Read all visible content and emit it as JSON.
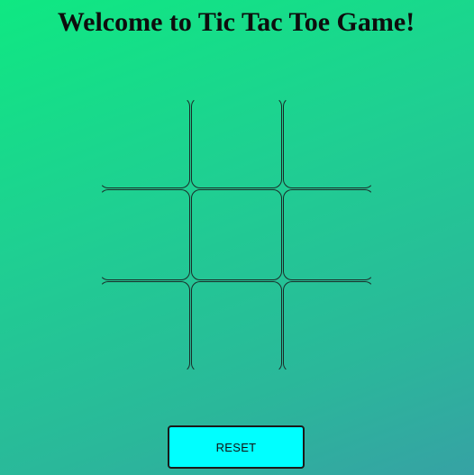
{
  "header": {
    "title": "Welcome to Tic Tac Toe Game!"
  },
  "board": {
    "cells": [
      "",
      "",
      "",
      "",
      "",
      "",
      "",
      "",
      ""
    ]
  },
  "controls": {
    "reset_label": "RESET"
  },
  "colors": {
    "gradient_start": "#0fe882",
    "gradient_end": "#36a2a4",
    "button_bg": "#00ffff",
    "grid_line": "#1b2b28"
  }
}
